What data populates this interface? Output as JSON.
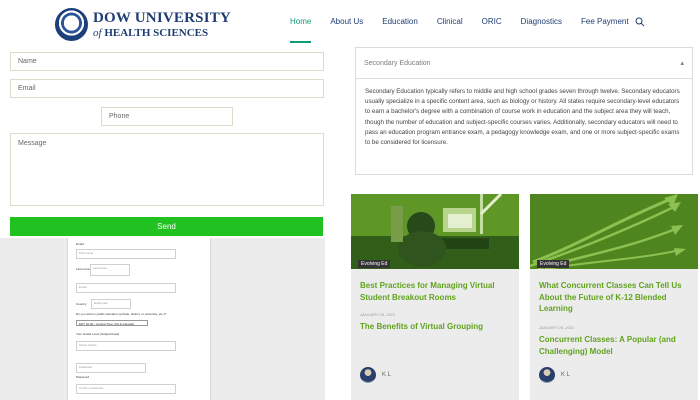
{
  "header": {
    "logo_line1": "DOW UNIVERSITY",
    "logo_of": "of",
    "logo_line2": "HEALTH SCIENCES",
    "nav": [
      "Home",
      "About Us",
      "Education",
      "Clinical",
      "ORIC",
      "Diagnostics",
      "Fee Payment"
    ]
  },
  "form": {
    "name_placeholder": "Name",
    "email_placeholder": "Email",
    "phone_placeholder": "Phone",
    "message_placeholder": "Message",
    "send_label": "Send"
  },
  "embedded_form": {
    "labels": [
      "Email:",
      "Last name",
      "Email",
      "Country",
      "Do you work in public education (private, district, or university, etc.)?",
      "Your Grade Level (Subject/Area)",
      "Select Grade",
      "Password",
      "Confirm password"
    ],
    "fields": [
      "First name",
      "Last name",
      "Email",
      "Enterprise",
      "Password",
      "Confirm password"
    ],
    "selects": [
      "EDT 20.00 - Central Time (US & Canada)"
    ]
  },
  "accordion": {
    "title": "Secondary Education",
    "body": "Secondary Education typically refers to middle and high school grades seven through twelve. Secondary educators usually specialize in a specific content area, such as biology or history. All states require secondary-level educators to earn a bachelor's degree with a combination of course work in education and the subject area they will teach, though the number of education and subject-specific courses varies. Additionally, secondary educators will need to pass an education program entrance exam, a pedagogy knowledge exam, and one or more subject-specific exams to be considered for licensure."
  },
  "cards": [
    {
      "tag": "Evolving Ed",
      "title": "Best Practices for Managing Virtual Student Breakout Rooms",
      "date": "JANUARY 26, 2021",
      "subtitle": "The Benefits of Virtual Grouping",
      "author": "K L"
    },
    {
      "tag": "Evolving Ed",
      "title": "What Concurrent Classes Can Tell Us About the Future of K-12 Blended Learning",
      "date": "JANUARY 26, 2021",
      "subtitle": "Concurrent Classes: A Popular (and Challenging) Model",
      "author": "K L"
    }
  ]
}
